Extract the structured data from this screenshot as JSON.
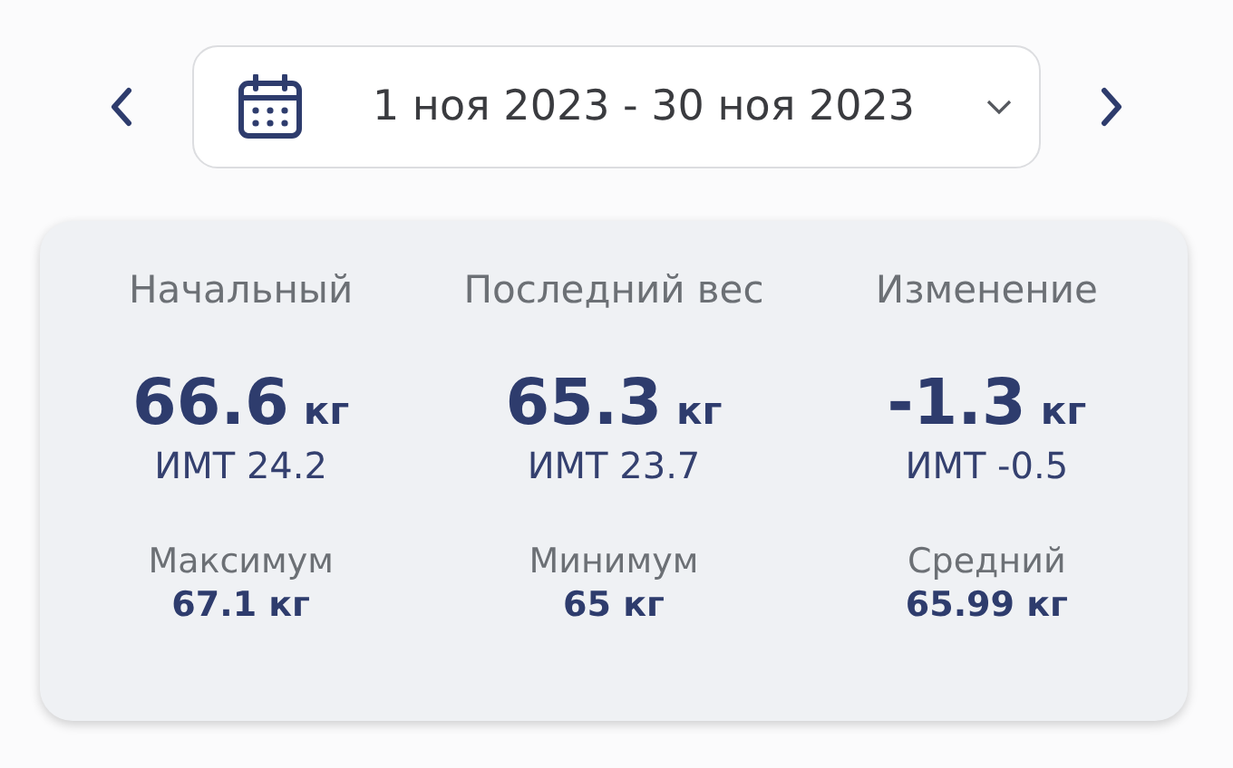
{
  "date_range": {
    "text": "1 ноя 2023 - 30 ноя 2023"
  },
  "summary": [
    {
      "label": "Начальный",
      "value": "66.6",
      "unit": "кг",
      "bmi": "ИМТ 24.2"
    },
    {
      "label": "Последний вес",
      "value": "65.3",
      "unit": "кг",
      "bmi": "ИМТ 23.7"
    },
    {
      "label": "Изменение",
      "value": "-1.3",
      "unit": "кг",
      "bmi": "ИМТ -0.5"
    }
  ],
  "details": [
    {
      "label": "Максимум",
      "value": "67.1 кг"
    },
    {
      "label": "Минимум",
      "value": "65 кг"
    },
    {
      "label": "Средний",
      "value": "65.99 кг"
    }
  ]
}
